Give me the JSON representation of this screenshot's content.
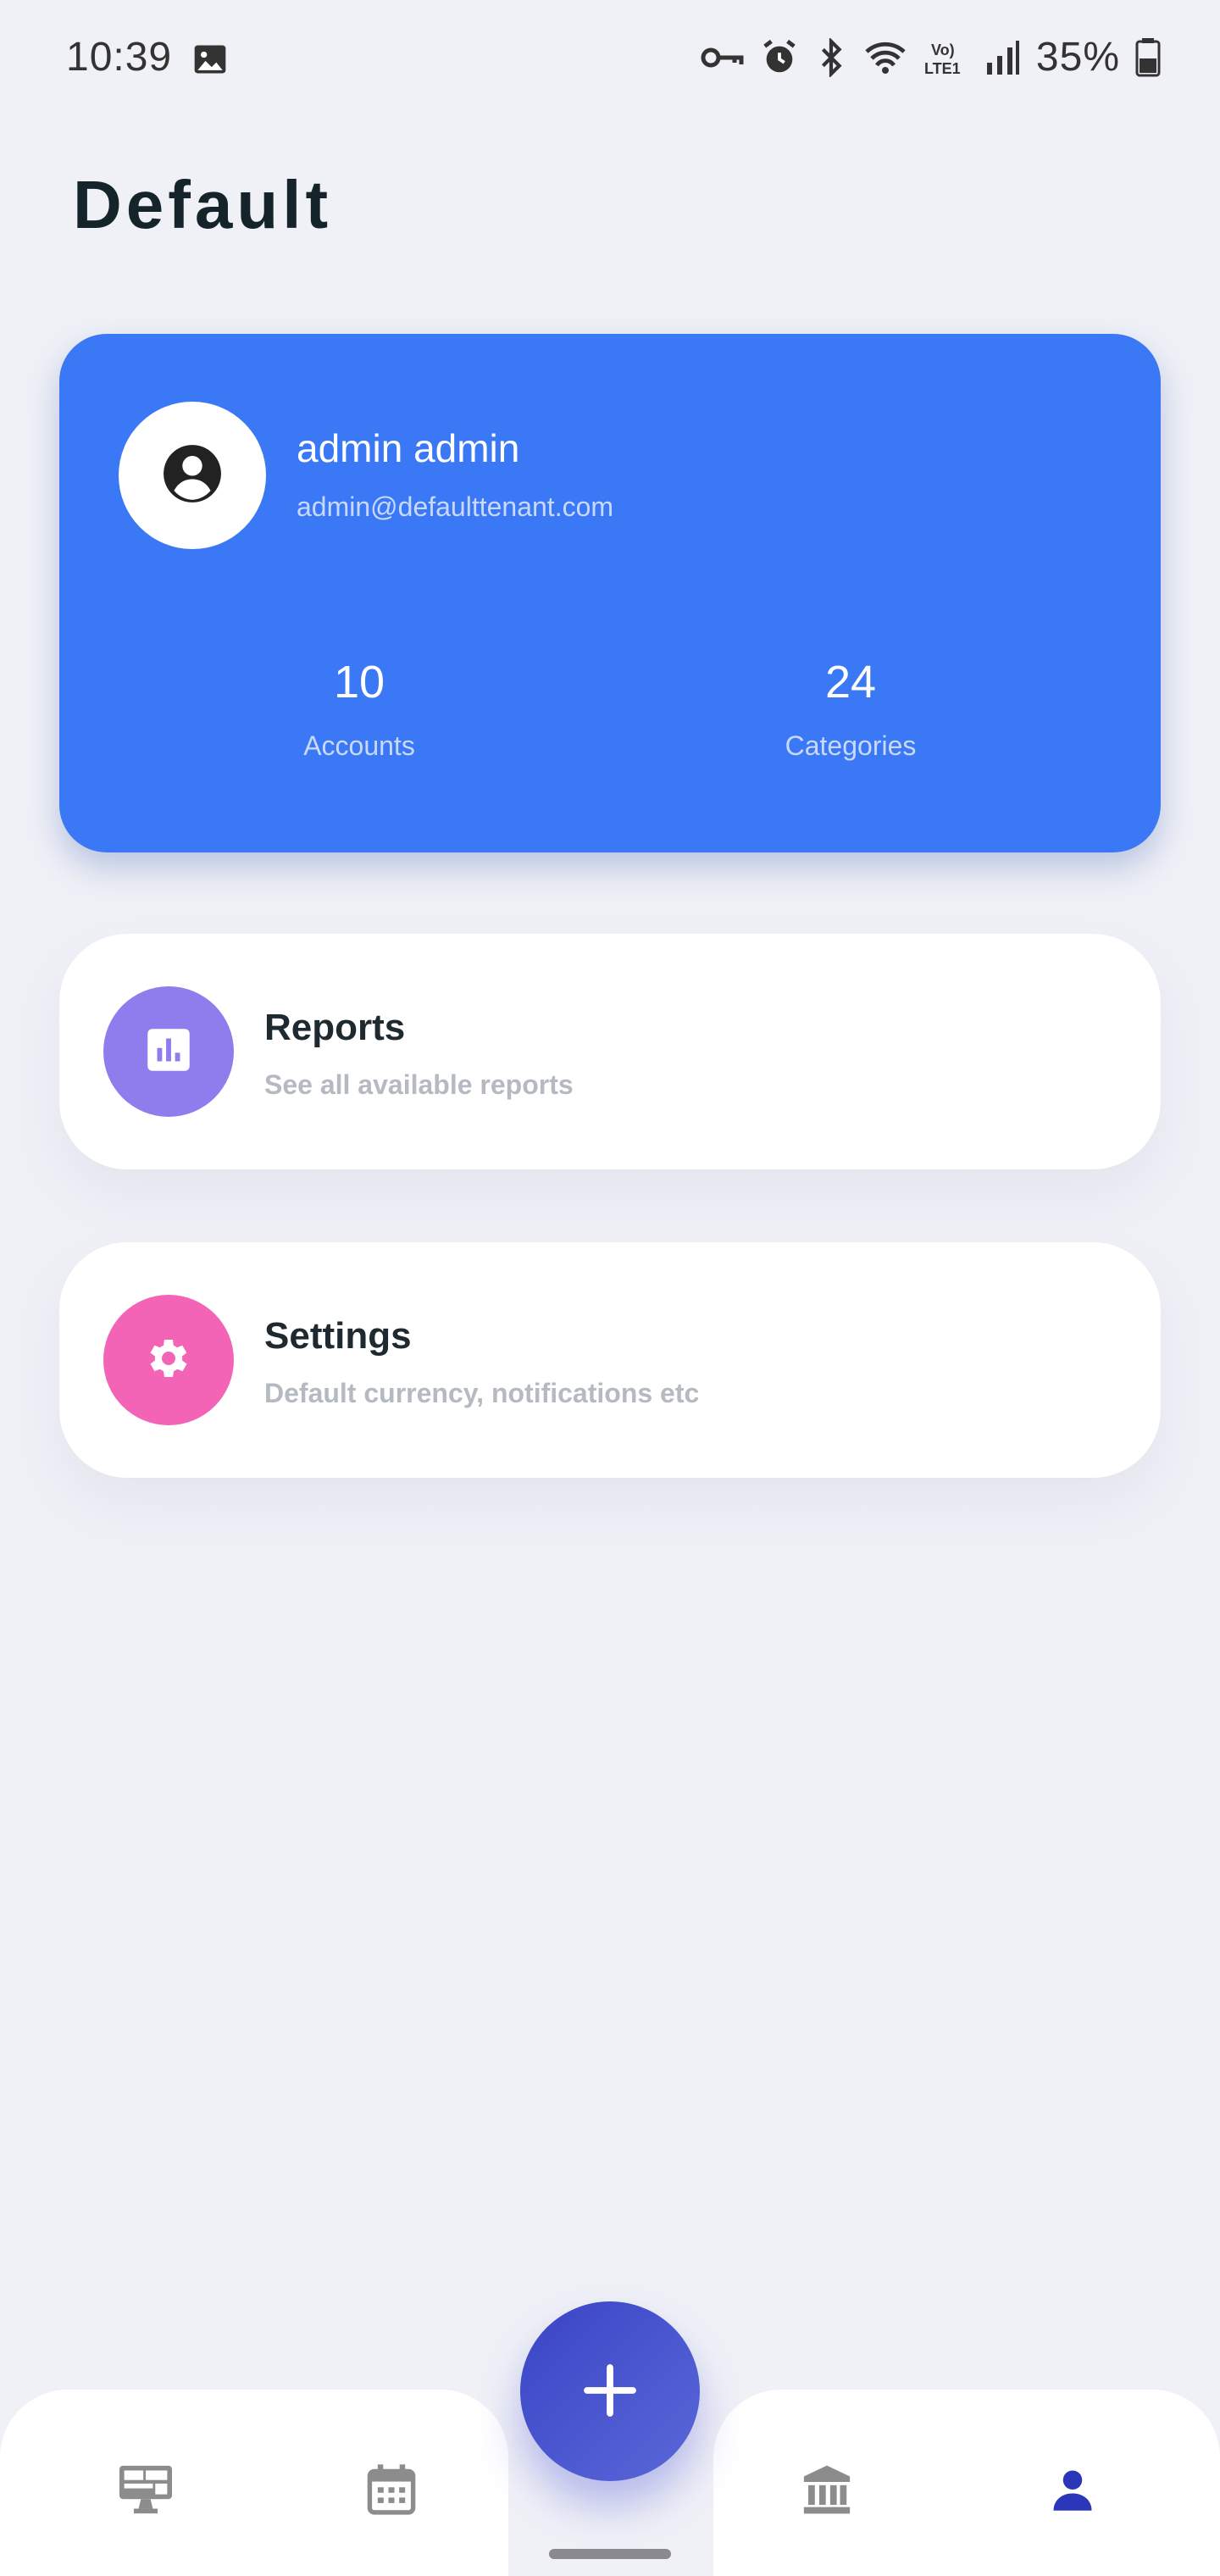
{
  "status_bar": {
    "time": "10:39",
    "battery": "35%",
    "icons": [
      "image-icon",
      "key-icon",
      "alarm-icon",
      "bluetooth-icon",
      "wifi-icon",
      "volte-lte-icon",
      "signal-icon",
      "battery-icon"
    ]
  },
  "header": {
    "title": "Default"
  },
  "profile": {
    "name": "admin admin",
    "email": "admin@defaulttenant.com",
    "avatar_icon": "account-circle-icon",
    "stats": [
      {
        "value": "10",
        "label": "Accounts"
      },
      {
        "value": "24",
        "label": "Categories"
      }
    ],
    "card_color": "#3b78f6"
  },
  "menu": [
    {
      "title": "Reports",
      "subtitle": "See all available reports",
      "icon": "bar-chart-icon",
      "color": "#8f7ded"
    },
    {
      "title": "Settings",
      "subtitle": "Default currency, notifications etc",
      "icon": "gear-icon",
      "color": "#f364b6"
    }
  ],
  "bottom_nav": {
    "items": [
      {
        "icon": "dashboard-icon",
        "active": false
      },
      {
        "icon": "calendar-icon",
        "active": false
      },
      {
        "icon": "bank-icon",
        "active": false
      },
      {
        "icon": "person-icon",
        "active": true
      }
    ],
    "fab_icon": "plus-icon",
    "active_color": "#2a37b8",
    "inactive_color": "#8c8c8c"
  }
}
